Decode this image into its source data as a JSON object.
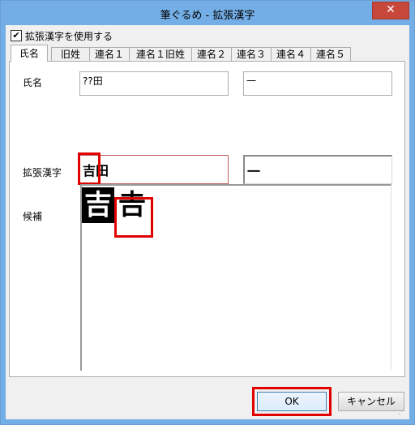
{
  "window": {
    "title": "筆ぐるめ - 拡張漢字",
    "close_label": "✕"
  },
  "options": {
    "use_extended_kanji_label": "拡張漢字を使用する",
    "use_extended_kanji_checked": true
  },
  "tabs": [
    {
      "label": "氏名",
      "active": true
    },
    {
      "label": "旧姓",
      "active": false
    },
    {
      "label": "連名１",
      "active": false
    },
    {
      "label": "連名１旧姓",
      "active": false
    },
    {
      "label": "連名２",
      "active": false
    },
    {
      "label": "連名３",
      "active": false
    },
    {
      "label": "連名４",
      "active": false
    },
    {
      "label": "連名５",
      "active": false
    }
  ],
  "form": {
    "name_label": "氏名",
    "surname_value": "??田",
    "given_value": "一",
    "kanji_label": "拡張漢字",
    "kanji_surname_value": "吉田",
    "kanji_given_value": "一",
    "candidates_label": "候補",
    "candidates": [
      "吉",
      "𠮷"
    ]
  },
  "buttons": {
    "ok": "OK",
    "cancel": "キャンセル"
  }
}
